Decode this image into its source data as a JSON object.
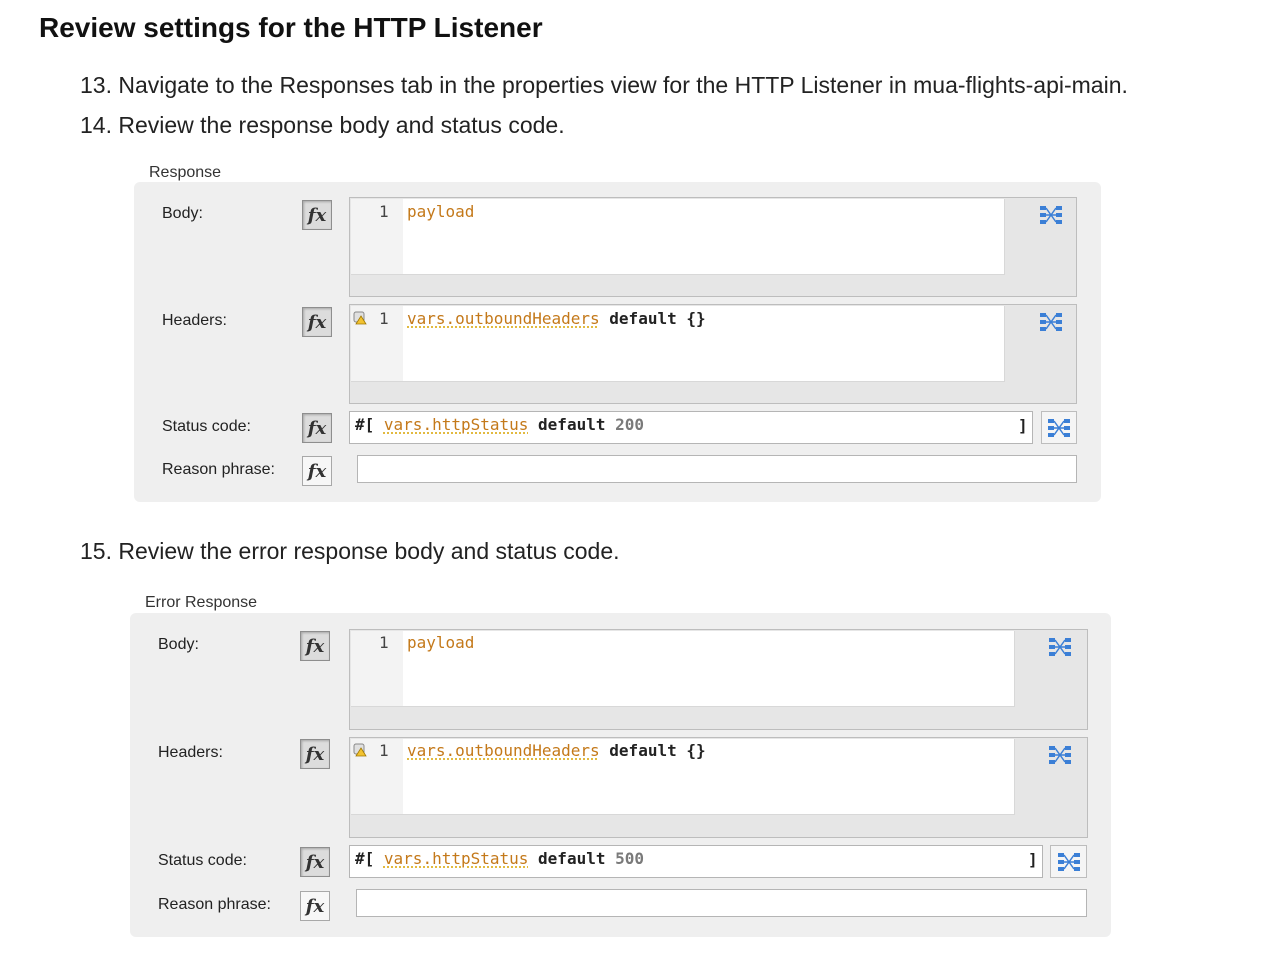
{
  "title": "Review settings for the HTTP Listener",
  "steps": {
    "s13": "13. Navigate to the Responses tab in the properties view for the HTTP Listener in mua-flights-api-main.",
    "s14": "14. Review the response body and status code.",
    "s15": "15. Review the error response body and status code."
  },
  "response": {
    "section_label": "Response",
    "body_label": "Body:",
    "headers_label": "Headers:",
    "status_label": "Status code:",
    "reason_label": "Reason phrase:",
    "fx_label": "fx",
    "line_number": "1",
    "body_code": "payload",
    "headers_code": {
      "ident": "vars.outboundHeaders",
      "rest": " default {}"
    },
    "status_code": {
      "prefix": "#[ ",
      "ident": "vars.httpStatus",
      "kw": " default ",
      "num": "200",
      "close": "]"
    },
    "reason_value": ""
  },
  "error_response": {
    "section_label": "Error Response",
    "body_label": "Body:",
    "headers_label": "Headers:",
    "status_label": "Status code:",
    "reason_label": "Reason phrase:",
    "fx_label": "fx",
    "line_number": "1",
    "body_code": "payload",
    "headers_code": {
      "ident": "vars.outboundHeaders",
      "rest": " default {}"
    },
    "status_code": {
      "prefix": "#[ ",
      "ident": "vars.httpStatus",
      "kw": " default ",
      "num": "500",
      "close": "]"
    },
    "reason_value": ""
  },
  "icons": {
    "fx": "fx-toggle-icon",
    "warning": "warning-icon",
    "map": "transform-map-icon"
  },
  "colors": {
    "keyword_orange": "#c4791a",
    "panel_bg": "#efefef",
    "map_icon_blue": "#3b7fd6"
  }
}
